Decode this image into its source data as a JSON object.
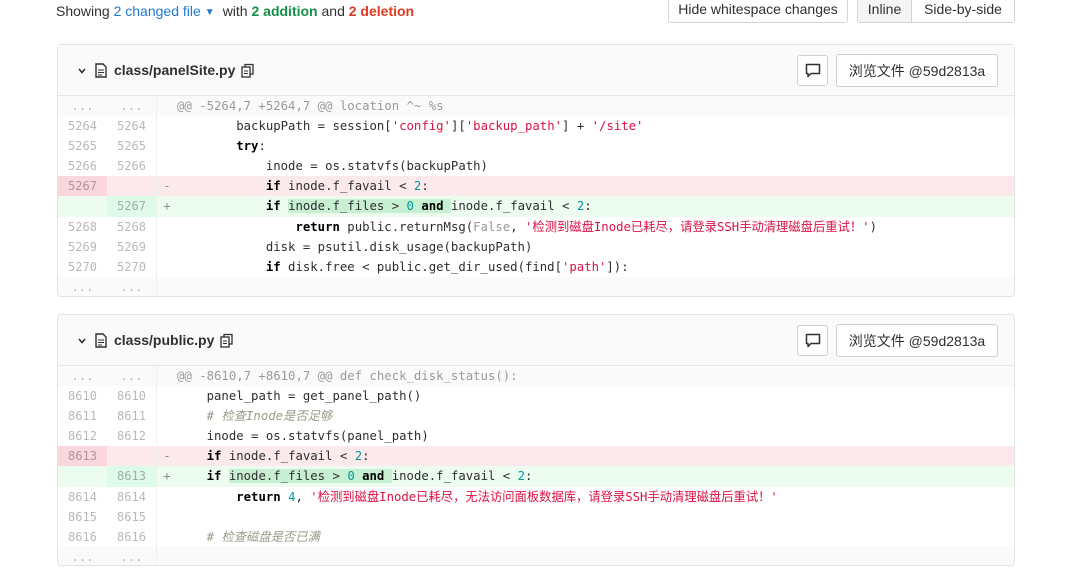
{
  "summary": {
    "prefix": "Showing",
    "changed": "2 changed file",
    "with": "with",
    "additions": "2 addition",
    "and": "and",
    "deletions": "2 deletion"
  },
  "toolbar": {
    "whitespace_label": "Hide whitespace changes",
    "inline_label": "Inline",
    "sbs_label": "Side-by-side"
  },
  "files": [
    {
      "path": "class/panelSite.py",
      "view_label": "浏览文件 @59d2813a",
      "hunk": "@@ -5264,7 +5264,7 @@ location ^~ %s",
      "lines": [
        {
          "old": "5264",
          "new": "5264",
          "type": "ctx"
        },
        {
          "old": "5265",
          "new": "5265",
          "type": "ctx"
        },
        {
          "old": "5266",
          "new": "5266",
          "type": "ctx"
        },
        {
          "old": "5267",
          "new": "",
          "type": "del"
        },
        {
          "old": "",
          "new": "5267",
          "type": "add"
        },
        {
          "old": "5268",
          "new": "5268",
          "type": "ctx"
        },
        {
          "old": "5269",
          "new": "5269",
          "type": "ctx"
        },
        {
          "old": "5270",
          "new": "5270",
          "type": "ctx"
        }
      ]
    },
    {
      "path": "class/public.py",
      "view_label": "浏览文件 @59d2813a",
      "hunk": "@@ -8610,7 +8610,7 @@ def check_disk_status():",
      "lines": [
        {
          "old": "8610",
          "new": "8610",
          "type": "ctx"
        },
        {
          "old": "8611",
          "new": "8611",
          "type": "ctx"
        },
        {
          "old": "8612",
          "new": "8612",
          "type": "ctx"
        },
        {
          "old": "8613",
          "new": "",
          "type": "del"
        },
        {
          "old": "",
          "new": "8613",
          "type": "add"
        },
        {
          "old": "8614",
          "new": "8614",
          "type": "ctx"
        },
        {
          "old": "8615",
          "new": "8615",
          "type": "ctx"
        },
        {
          "old": "8616",
          "new": "8616",
          "type": "ctx"
        }
      ]
    }
  ],
  "code": {
    "f1": {
      "l1_a": "backupPath = session[",
      "l1_s1": "'config'",
      "l1_b": "][",
      "l1_s2": "'backup_path'",
      "l1_c": "] + ",
      "l1_s3": "'/site'",
      "l2_kw": "try",
      "l2_a": ":",
      "l3": "inode = os.statvfs(backupPath)",
      "l4_kw": "if",
      "l4_a": " inode.f_favail < ",
      "l4_n": "2",
      "l4_b": ":",
      "l5_kw": "if",
      "l5_hl_a": "inode.f_files > ",
      "l5_hl_n": "0",
      "l5_hl_kw": "and",
      "l5_b": "inode.f_favail < ",
      "l5_n": "2",
      "l5_c": ":",
      "l6_kw": "return",
      "l6_a": " public.returnMsg(",
      "l6_const": "False",
      "l6_b": ", ",
      "l6_s": "'检测到磁盘Inode已耗尽，请登录SSH手动清理磁盘后重试！'",
      "l6_c": ")",
      "l7": "disk = psutil.disk_usage(backupPath)",
      "l8_kw": "if",
      "l8_a": " disk.free < public.get_dir_used(find[",
      "l8_s": "'path'",
      "l8_b": "]):"
    },
    "f2": {
      "l1": "panel_path = get_panel_path()",
      "l2_cm": "# 检查Inode是否足够",
      "l3": "inode = os.statvfs(panel_path)",
      "l4_kw": "if",
      "l4_a": " inode.f_favail < ",
      "l4_n": "2",
      "l4_b": ":",
      "l5_kw": "if",
      "l5_hl_a": "inode.f_files > ",
      "l5_hl_n": "0",
      "l5_hl_kw": "and",
      "l5_b": "inode.f_favail < ",
      "l5_n": "2",
      "l5_c": ":",
      "l6_kw": "return",
      "l6_n": "4",
      "l6_b": ", ",
      "l6_s": "'检测到磁盘Inode已耗尽，无法访问面板数据库，请登录SSH手动清理磁盘后重试！'",
      "l8_cm": "# 检查磁盘是否已满"
    }
  },
  "signs": {
    "del": "-",
    "add": "+"
  },
  "ellipsis": "...",
  "icons": [
    "chevron-down-icon",
    "file-icon",
    "copy-icon",
    "comment-icon"
  ],
  "colors": {
    "link": "#1f78d1",
    "addition": "#168f48",
    "deletion": "#db3b21",
    "del_bg": "#fbe9eb",
    "add_bg": "#ecfdf0"
  }
}
